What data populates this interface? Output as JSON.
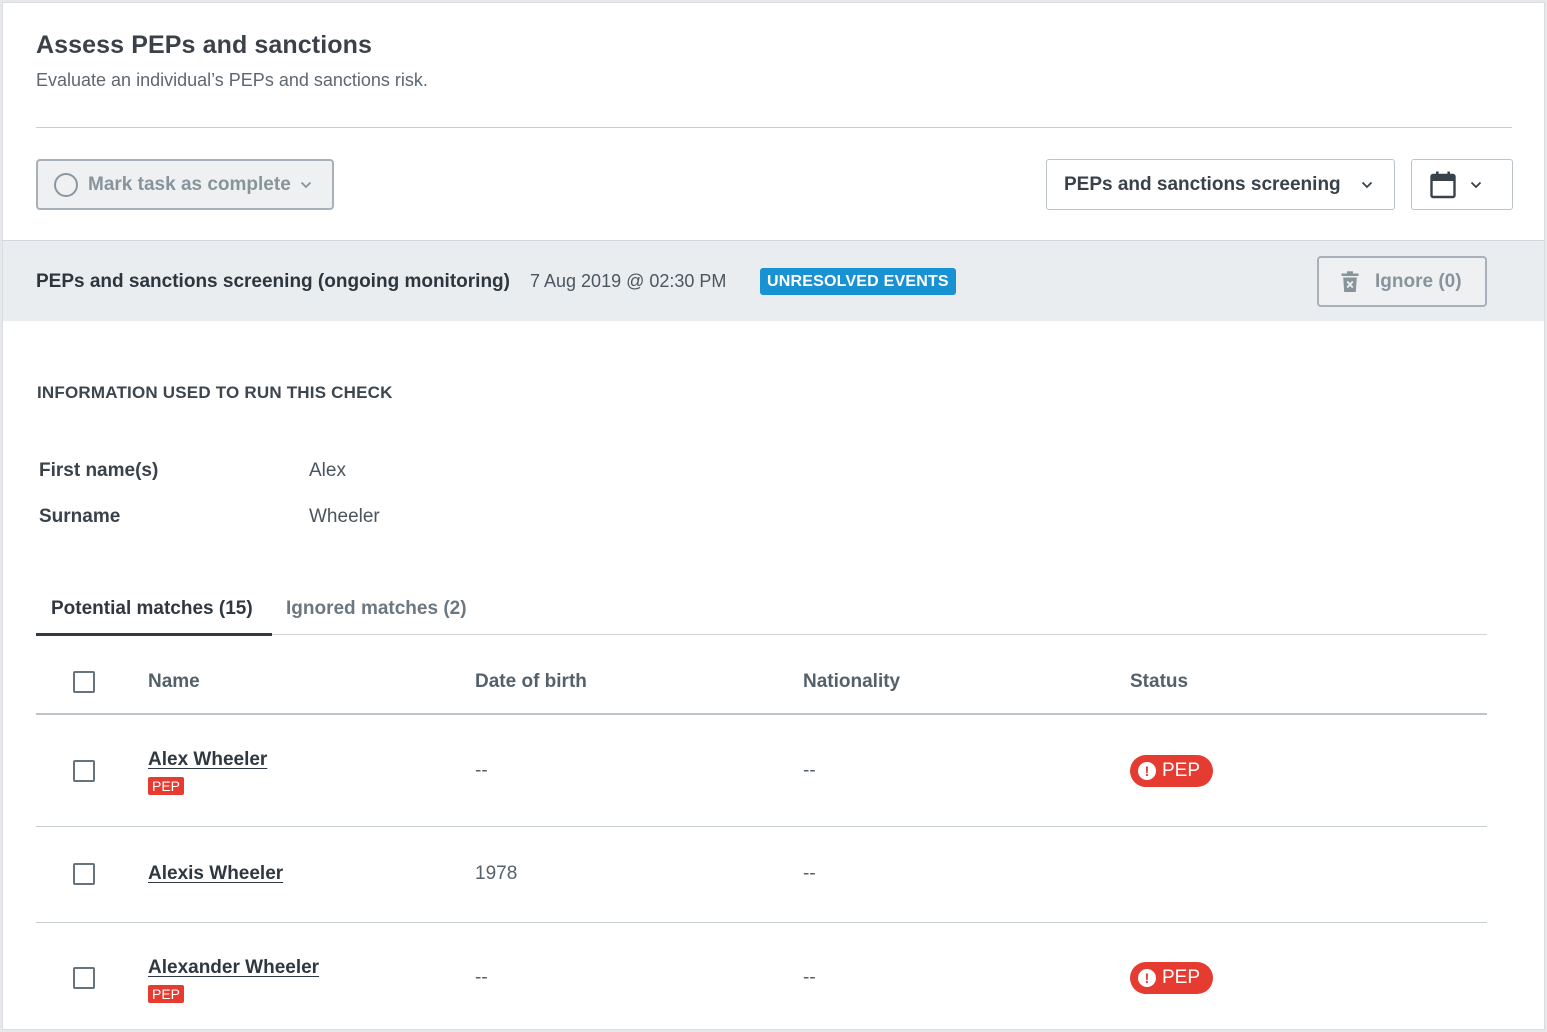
{
  "header": {
    "title": "Assess PEPs and sanctions",
    "subtitle": "Evaluate an individual’s PEPs and sanctions risk."
  },
  "toolbar": {
    "mark_complete_label": "Mark task as complete",
    "screening_select_label": "PEPs and sanctions screening",
    "icons": {
      "complete": "circle-icon",
      "date": "calendar-icon",
      "dropdown": "chevron-down-icon"
    }
  },
  "check": {
    "title": "PEPs and sanctions screening (ongoing monitoring)",
    "date": "7 Aug 2019 @ 02:30 PM",
    "status_badge": "UNRESOLVED EVENTS",
    "ignore_label": "Ignore (0)",
    "colors": {
      "badge": "#1992d4",
      "pep": "#e53b31"
    }
  },
  "info": {
    "heading": "INFORMATION USED TO RUN THIS CHECK",
    "fields": [
      {
        "label": "First name(s)",
        "value": "Alex"
      },
      {
        "label": "Surname",
        "value": "Wheeler"
      }
    ]
  },
  "tabs": [
    {
      "label": "Potential matches (15)",
      "active": true
    },
    {
      "label": "Ignored matches (2)",
      "active": false
    }
  ],
  "table": {
    "columns": [
      "Name",
      "Date of birth",
      "Nationality",
      "Status"
    ],
    "rows": [
      {
        "name": "Alex Wheeler",
        "tag": "PEP",
        "dob": "--",
        "nationality": "--",
        "status": "PEP"
      },
      {
        "name": "Alexis Wheeler",
        "tag": "",
        "dob": "1978",
        "nationality": "--",
        "status": ""
      },
      {
        "name": "Alexander Wheeler",
        "tag": "PEP",
        "dob": "--",
        "nationality": "--",
        "status": "PEP"
      }
    ]
  }
}
